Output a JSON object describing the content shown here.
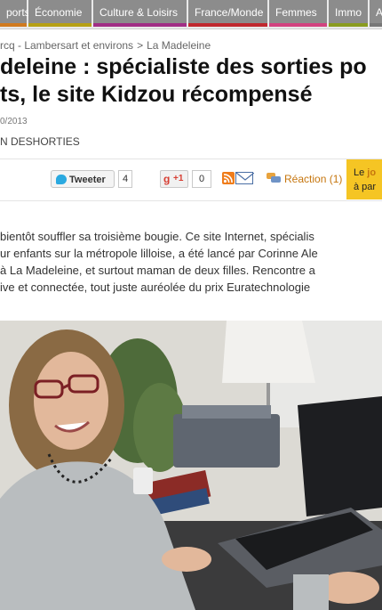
{
  "nav": {
    "items": [
      "ports",
      "Économie",
      "Culture & Loisirs",
      "France/Monde",
      "Femmes",
      "Immo",
      "A"
    ]
  },
  "breadcrumb": {
    "items": [
      "rcq - Lambersart et environs",
      "La Madeleine"
    ],
    "separator": ">"
  },
  "article": {
    "title_line1": "deleine : spécialiste des sorties po",
    "title_line2": "ts, le site Kidzou récompensé",
    "date": "0/2013",
    "author": "N DESHORTIES",
    "paragraph_lines": [
      "bientôt souffler sa troisième bougie. Ce site Internet, spécialis",
      "ur enfants sur la métropole lilloise, a été lancé par Corinne Ale",
      "à La Madeleine, et surtout maman de deux filles. Rencontre a",
      "ive et connectée, tout juste auréolée du prix Euratechnologie"
    ]
  },
  "share": {
    "tweet_label": "Tweeter",
    "tweet_count": "4",
    "gplus_label": "+1",
    "gplus_count": "0",
    "reaction_label": "Réaction (1)"
  },
  "promo": {
    "line1_prefix": "Le ",
    "line1_bold": "jo",
    "line2": "à par"
  },
  "colors": {
    "nav_bg": "#8c8c8c",
    "reaction": "#c6760e",
    "promo_bg": "#f5c524",
    "twitter": "#2aa9e0"
  },
  "photo": {
    "description": "woman-at-laptop"
  }
}
